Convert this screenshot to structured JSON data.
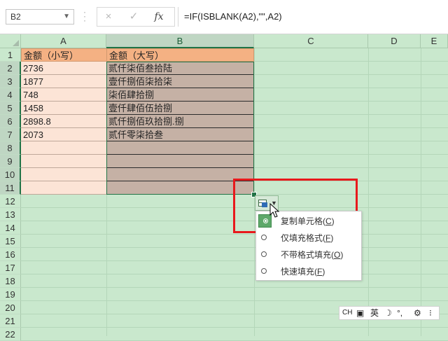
{
  "formula_bar": {
    "name_box": "B2",
    "cancel_icon": "×",
    "enter_icon": "✓",
    "fx_label": "fx",
    "formula": "=IF(ISBLANK(A2),\"\",A2)"
  },
  "columns": [
    "A",
    "B",
    "C",
    "D",
    "E"
  ],
  "rows": [
    "1",
    "2",
    "3",
    "4",
    "5",
    "6",
    "7",
    "8",
    "9",
    "10",
    "11",
    "12",
    "13",
    "14",
    "15",
    "16",
    "17",
    "18",
    "19",
    "20",
    "21",
    "22"
  ],
  "sheet": {
    "header_a": "金额（小写）",
    "header_b": "金额（大写）",
    "col_a": [
      "2736",
      "1877",
      "748",
      "1458",
      "2898.8",
      "2073",
      "",
      "",
      "",
      ""
    ],
    "col_b": [
      "贰仟柒佰叁拾陆",
      "壹仟捌佰柒拾柒",
      "柒佰肆拾捌",
      "壹仟肆佰伍拾捌",
      "贰仟捌佰玖拾捌.捌",
      "贰仟零柒拾叁",
      "",
      "",
      "",
      ""
    ]
  },
  "autofill_menu": {
    "items": [
      {
        "label": "复制单元格(",
        "key": "C",
        "end": ")",
        "selected": true
      },
      {
        "label": "仅填充格式(",
        "key": "F",
        "end": ")",
        "selected": false
      },
      {
        "label": "不带格式填充(",
        "key": "O",
        "end": ")",
        "selected": false
      },
      {
        "label": "快速填充(",
        "key": "F",
        "end": ")",
        "selected": false
      }
    ]
  },
  "ime_bar": {
    "mode": "CH",
    "lang": "英",
    "moon": "☽",
    "punct": "°,",
    "gear": "⚙",
    "more": "⁝"
  },
  "colors": {
    "header_fill": "#f4b183",
    "col_a_fill": "#fce4d6",
    "col_b_fill": "#c5b1a5",
    "highlight_box": "#e8191c",
    "excel_green": "#217346"
  }
}
